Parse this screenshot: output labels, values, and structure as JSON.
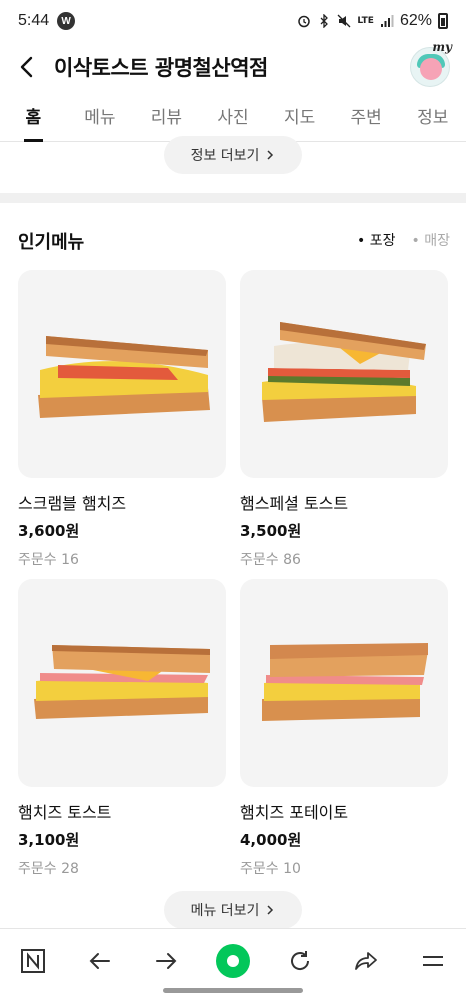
{
  "status": {
    "time": "5:44",
    "app_badge": "W",
    "network": "LTE",
    "battery": "62%"
  },
  "header": {
    "title": "이삭토스트 광명철산역점",
    "avatar_label": "my"
  },
  "tabs": [
    {
      "label": "홈",
      "active": true
    },
    {
      "label": "메뉴"
    },
    {
      "label": "리뷰"
    },
    {
      "label": "사진"
    },
    {
      "label": "지도"
    },
    {
      "label": "주변"
    },
    {
      "label": "정보"
    }
  ],
  "info_more": "정보 더보기",
  "popular": {
    "title": "인기메뉴",
    "filters": [
      {
        "label": "포장",
        "active": true
      },
      {
        "label": "매장",
        "active": false
      }
    ],
    "items": [
      {
        "name": "스크램블 햄치즈",
        "price": "3,600원",
        "orders": "주문수 16"
      },
      {
        "name": "햄스페셜 토스트",
        "price": "3,500원",
        "orders": "주문수 86"
      },
      {
        "name": "햄치즈 토스트",
        "price": "3,100원",
        "orders": "주문수 28"
      },
      {
        "name": "햄치즈 포테이토",
        "price": "4,000원",
        "orders": "주문수 10"
      }
    ]
  },
  "menu_more": "메뉴 더보기",
  "colors": {
    "accent": "#03c75a",
    "bread": "#e8a566",
    "egg": "#f6d24a"
  }
}
